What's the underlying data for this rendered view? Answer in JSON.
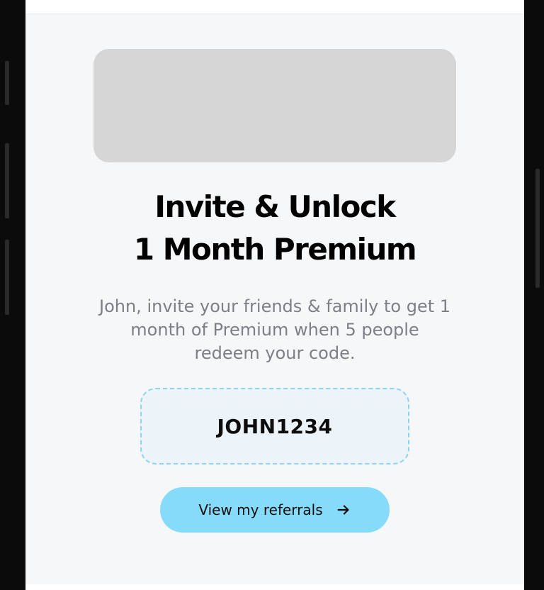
{
  "referral": {
    "title_line1": "Invite & Unlock",
    "title_line2": "1 Month Premium",
    "description": "John, invite your friends & family to get 1 month of Premium when 5 people redeem your code.",
    "code": "JOHN1234",
    "view_referrals_label": "View my referrals",
    "button_icon": "arrow-right-icon"
  },
  "colors": {
    "background": "#f6f7f9",
    "button": "#86dbfb",
    "code_border": "#8fd3f4",
    "code_background": "#ecf3f9",
    "placeholder": "#d6d6d6"
  }
}
